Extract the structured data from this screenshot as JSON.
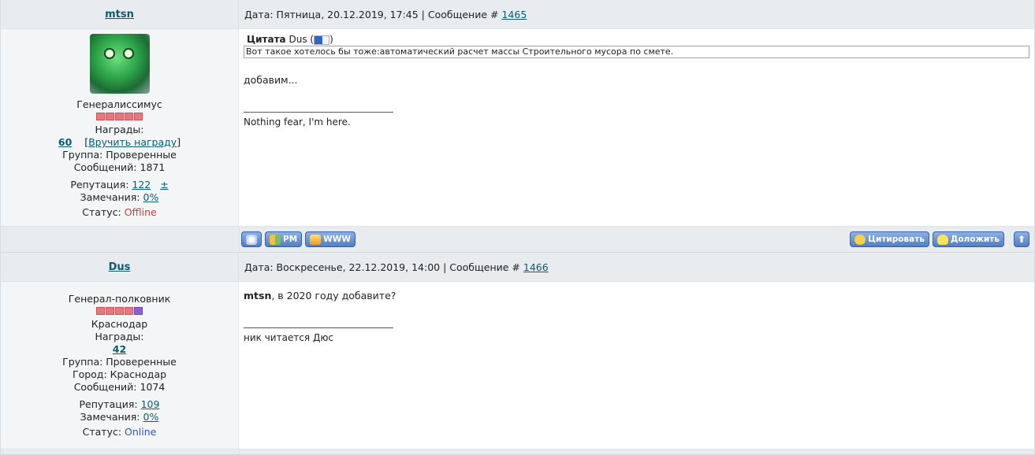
{
  "posts": [
    {
      "author": "mtsn",
      "date_text": "Дата: Пятница, 20.12.2019, 17:45 | Сообщение #",
      "message_number": "1465",
      "rank": "Генералиссимус",
      "awards_label": "Награды:",
      "awards_count": "60",
      "give_award_open": "[",
      "give_award_link": "Вручить награду",
      "give_award_close": "]",
      "group": "Группа: Проверенные",
      "messages": "Сообщений: 1871",
      "reputation_label": "Репутация:",
      "reputation_value": "122",
      "reputation_plusminus": "±",
      "warnings_label": "Замечания:",
      "warnings_value": "0%",
      "status_label": "Статус:",
      "status_value": "Offline",
      "quote_label": "Цитата",
      "quote_author": "Dus (",
      "quote_close": ")",
      "quote_text": "Вот такое хотелось бы тоже:автоматический расчет массы Строительного мусора по смете.",
      "body_text": "добавим...",
      "signature": "Nothing fear, I'm here."
    },
    {
      "author": "Dus",
      "date_text": "Дата: Воскресенье, 22.12.2019, 14:00 | Сообщение #",
      "message_number": "1466",
      "rank": "Генерал-полковник",
      "city_top": "Краснодар",
      "awards_label": "Награды:",
      "awards_count": "42",
      "group": "Группа: Проверенные",
      "city": "Город: Краснодар",
      "messages": "Сообщений: 1074",
      "reputation_label": "Репутация:",
      "reputation_value": "109",
      "warnings_label": "Замечания:",
      "warnings_value": "0%",
      "status_label": "Статус:",
      "status_value": "Online",
      "body_bold": "mtsn",
      "body_rest": ", в 2020 году добавите?",
      "signature": "ник читается Дюс"
    }
  ],
  "toolbar": {
    "pm_label": "PM",
    "www_label": "WWW",
    "quote_label": "Цитировать",
    "report_label": "Доложить",
    "up_arrow": "⬆"
  },
  "icons": {
    "profile": "profile-icon",
    "pm": "people-icon",
    "www": "home-icon",
    "quote": "speech-bubble-icon",
    "report": "bulb-icon",
    "up": "arrow-up-icon",
    "quote_link": "go-to-post-icon"
  },
  "colors": {
    "link": "#0b5b73",
    "offline": "#e23333",
    "online": "#2d52d0",
    "header_bg": "#e9ecef"
  }
}
